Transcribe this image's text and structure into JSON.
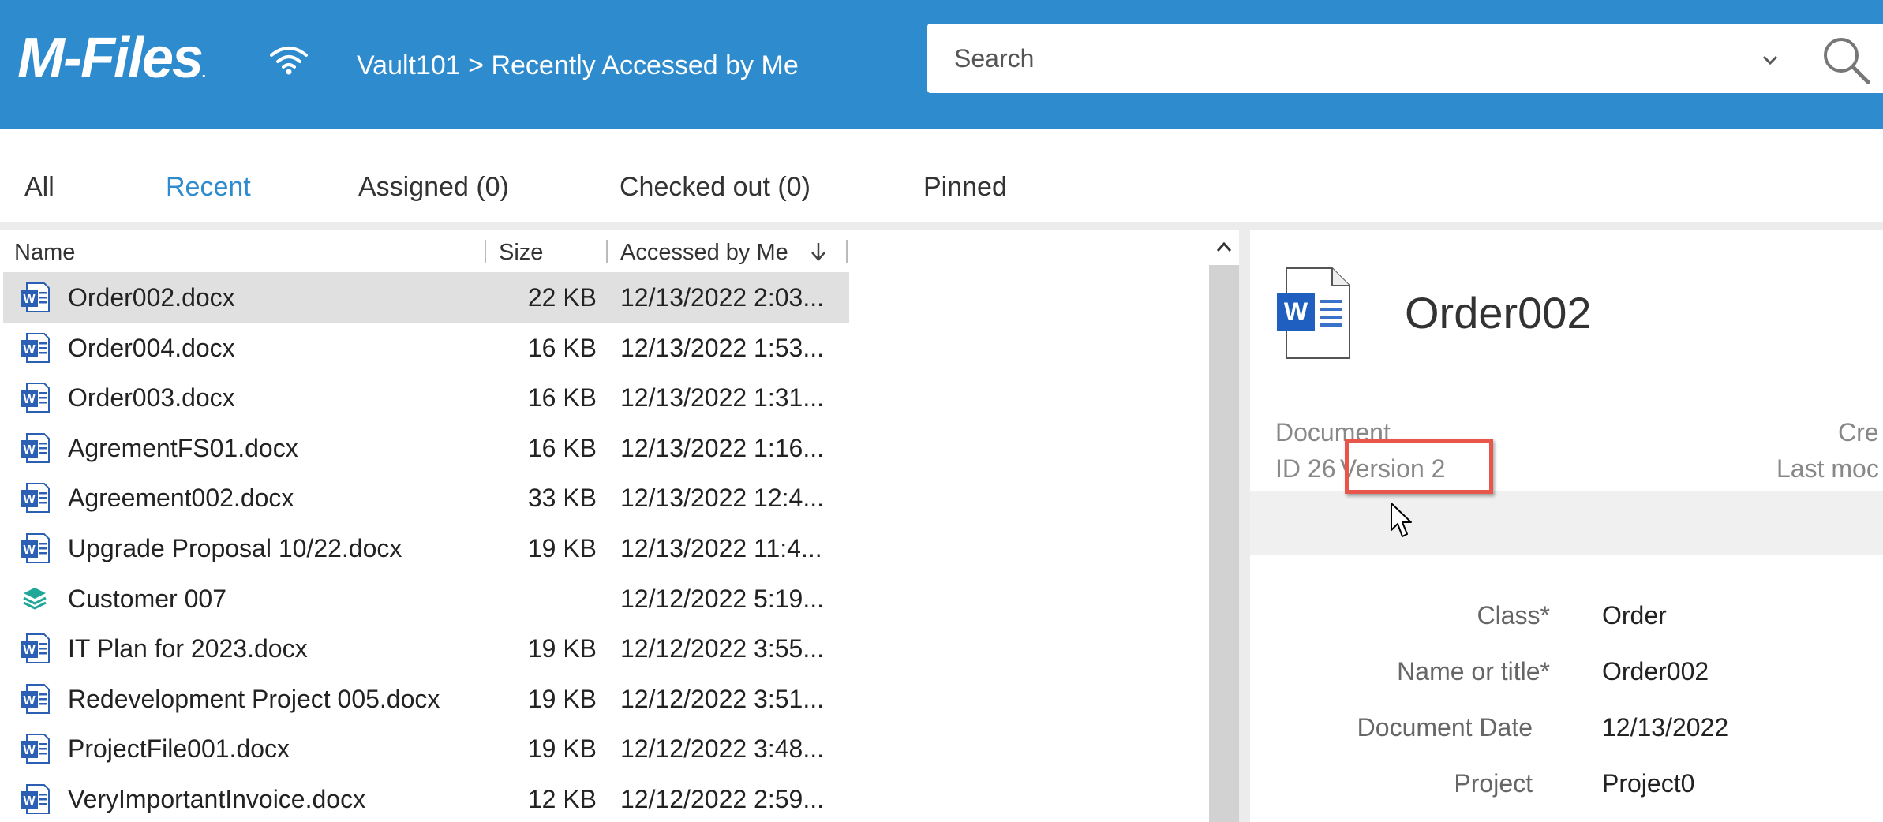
{
  "header": {
    "logo": "M-Files",
    "breadcrumb": "Vault101 > Recently Accessed by Me",
    "search_placeholder": "Search",
    "accent_color": "#2e8bcd"
  },
  "tabs": [
    {
      "label": "All"
    },
    {
      "label": "Recent",
      "active": true
    },
    {
      "label": "Assigned (0)"
    },
    {
      "label": "Checked out (0)"
    },
    {
      "label": "Pinned"
    }
  ],
  "list": {
    "columns": {
      "name": "Name",
      "size": "Size",
      "accessed": "Accessed by Me"
    },
    "rows": [
      {
        "icon": "word-doc-icon",
        "name": "Order002.docx",
        "size": "22 KB",
        "date": "12/13/2022 2:03...",
        "selected": true
      },
      {
        "icon": "word-doc-icon",
        "name": "Order004.docx",
        "size": "16 KB",
        "date": "12/13/2022 1:53..."
      },
      {
        "icon": "word-doc-icon",
        "name": "Order003.docx",
        "size": "16 KB",
        "date": "12/13/2022 1:31..."
      },
      {
        "icon": "word-doc-icon",
        "name": "AgrementFS01.docx",
        "size": "16 KB",
        "date": "12/13/2022 1:16..."
      },
      {
        "icon": "word-doc-icon",
        "name": "Agreement002.docx",
        "size": "33 KB",
        "date": "12/13/2022 12:4..."
      },
      {
        "icon": "word-doc-icon",
        "name": "Upgrade Proposal 10/22.docx",
        "size": "19 KB",
        "date": "12/13/2022 11:4..."
      },
      {
        "icon": "customer-layers-icon",
        "name": "Customer 007",
        "size": "",
        "date": "12/12/2022 5:19..."
      },
      {
        "icon": "word-doc-icon",
        "name": "IT Plan for 2023.docx",
        "size": "19 KB",
        "date": "12/12/2022 3:55..."
      },
      {
        "icon": "word-doc-icon",
        "name": "Redevelopment Project 005.docx",
        "size": "19 KB",
        "date": "12/12/2022 3:51..."
      },
      {
        "icon": "word-doc-icon",
        "name": "ProjectFile001.docx",
        "size": "19 KB",
        "date": "12/12/2022 3:48..."
      },
      {
        "icon": "word-doc-icon",
        "name": "VeryImportantInvoice.docx",
        "size": "12 KB",
        "date": "12/12/2022 2:59..."
      }
    ]
  },
  "detail": {
    "title": "Order002",
    "object_type": "Document",
    "id": "ID 26",
    "version": "Version 2",
    "created_label": "Cre",
    "last_modified_label": "Last moc",
    "properties": [
      {
        "label": "Class*",
        "value": "Order"
      },
      {
        "label": "Name or title*",
        "value": "Order002"
      },
      {
        "label": "Document Date",
        "value": "12/13/2022"
      },
      {
        "label": "Project",
        "value": "Project0"
      }
    ]
  }
}
